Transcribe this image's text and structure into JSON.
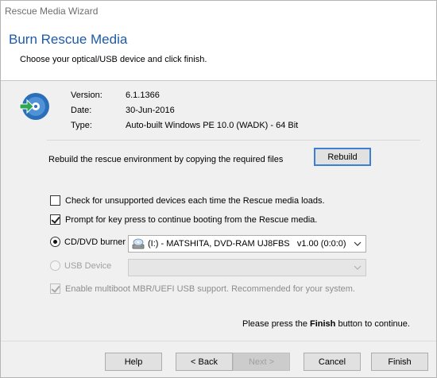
{
  "window": {
    "title": "Rescue Media Wizard"
  },
  "header": {
    "title": "Burn Rescue Media",
    "subtitle": "Choose your optical/USB device and click finish."
  },
  "info": {
    "icon": "disc-burn-icon",
    "rows": [
      {
        "label": "Version:",
        "value": "6.1.1366"
      },
      {
        "label": "Date:",
        "value": "30-Jun-2016"
      },
      {
        "label": "Type:",
        "value": "Auto-built Windows PE 10.0 (WADK) - 64 Bit"
      }
    ]
  },
  "rebuild": {
    "text": "Rebuild the rescue environment by copying the required files",
    "button": "Rebuild"
  },
  "options": {
    "check_unsupported": {
      "label": "Check for unsupported devices each time the Rescue media loads.",
      "checked": false
    },
    "prompt_keypress": {
      "label": "Prompt for key press to continue booting from the Rescue media.",
      "checked": true
    },
    "multiboot": {
      "label": "Enable multiboot MBR/UEFI USB support. Recommended for your system.",
      "checked": true,
      "disabled": true
    }
  },
  "device": {
    "cd_label": "CD/DVD burner",
    "cd_selected": true,
    "cd_value": "(I:) - MATSHITA, DVD-RAM UJ8FBS   v1.00 (0:0:0)",
    "usb_label": "USB Device",
    "usb_selected": false,
    "usb_value": ""
  },
  "finish_note": {
    "prefix": "Please press the ",
    "emph": "Finish",
    "suffix": " button to continue."
  },
  "buttons": {
    "help": "Help",
    "back": "< Back",
    "next": "Next >",
    "cancel": "Cancel",
    "finish": "Finish"
  },
  "colors": {
    "header_title": "#1e5aa8",
    "focus_border": "#3c7fd4",
    "icon_disc": "#2a6fb8",
    "icon_arrow": "#2fa84f"
  }
}
